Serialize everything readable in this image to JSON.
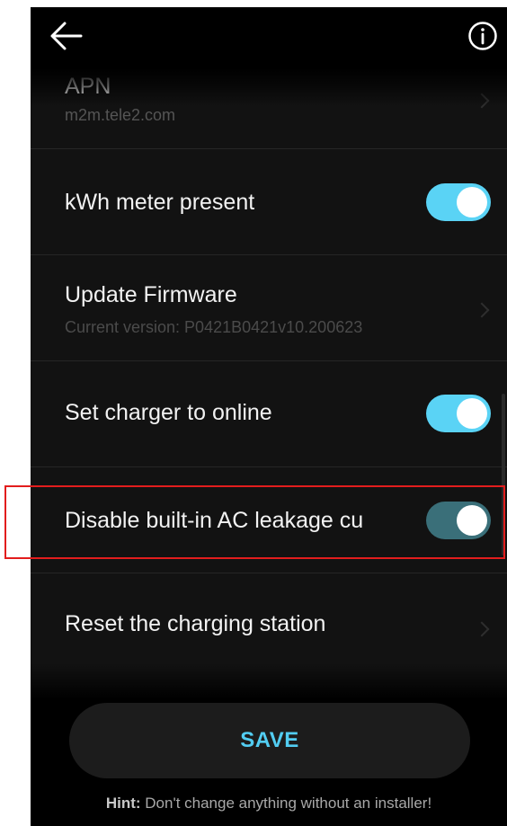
{
  "header": {
    "back_icon": "arrow-left-icon",
    "info_icon": "info-circle-icon"
  },
  "settings": {
    "apn": {
      "title": "APN",
      "value": "m2m.tele2.com"
    },
    "kwh_meter": {
      "title": "kWh meter present",
      "enabled": true
    },
    "firmware": {
      "title": "Update Firmware",
      "subtitle": "Current version:  P0421B0421v10.200623"
    },
    "online": {
      "title": "Set charger to online",
      "enabled": true
    },
    "leakage": {
      "title": "Disable built-in AC leakage cu",
      "enabled": true
    },
    "reset": {
      "title": "Reset the charging station"
    }
  },
  "footer": {
    "save_label": "SAVE",
    "hint_label": "Hint:",
    "hint_text": " Don't change anything without an installer!"
  },
  "colors": {
    "accent": "#5ad3f5",
    "toggle_dimmed": "#3a6f79",
    "highlight": "#e21d1d",
    "background": "#121212"
  }
}
